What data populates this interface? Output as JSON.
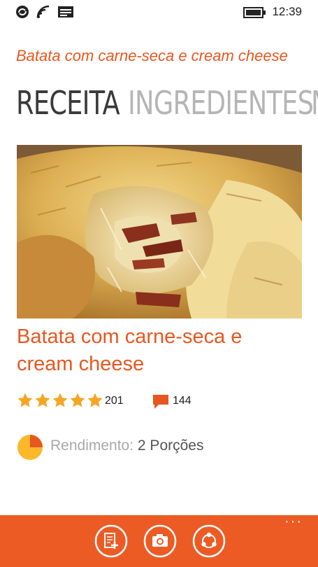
{
  "status_bar": {
    "time": "12:39",
    "icons": [
      "sync-icon",
      "wifi-icon",
      "message-icon",
      "battery-icon"
    ]
  },
  "app": {
    "title": "Batata com carne-seca e cream cheese",
    "accent_color": "#e8571f",
    "appbar_color": "#ec5b24"
  },
  "pivot": {
    "items": [
      "RECEITA",
      "INGREDIENTES",
      "M"
    ],
    "active_index": 0
  },
  "recipe": {
    "title": "Batata com carne-seca e cream cheese",
    "image": "hero-food-photo",
    "rating": {
      "stars": 5,
      "max_stars": 5,
      "count": "201",
      "star_color": "#f5a623"
    },
    "comments": {
      "count": "144",
      "icon": "comment-icon"
    },
    "servings": {
      "label": "Rendimento:",
      "value": "2 Porções",
      "pie_fraction": 0.25,
      "pie_color": "#fbb829",
      "pie_slice_color": "#e8571f"
    }
  },
  "app_bar": {
    "buttons": [
      {
        "icon": "add-list-icon"
      },
      {
        "icon": "camera-icon"
      },
      {
        "icon": "share-icon"
      }
    ],
    "more": "···"
  }
}
